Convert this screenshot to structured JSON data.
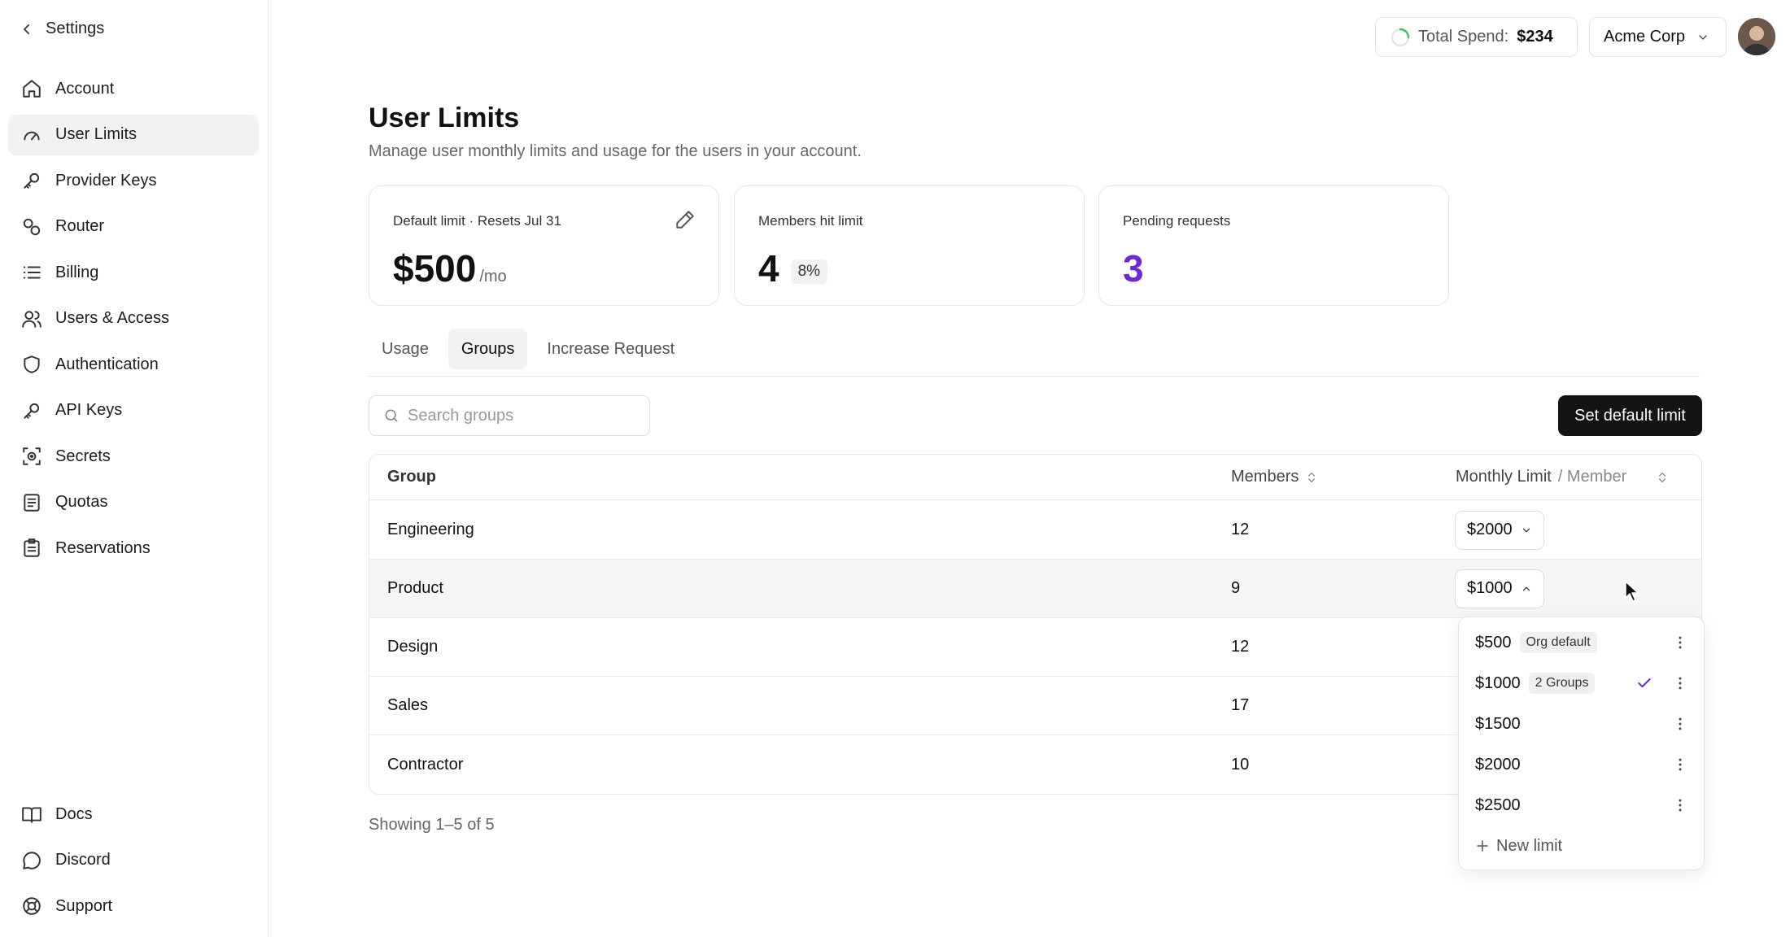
{
  "sidebar": {
    "back_label": "Settings",
    "items": [
      {
        "label": "Account",
        "icon": "home-icon"
      },
      {
        "label": "User Limits",
        "icon": "gauge-icon",
        "active": true
      },
      {
        "label": "Provider Keys",
        "icon": "key-icon"
      },
      {
        "label": "Router",
        "icon": "router-icon"
      },
      {
        "label": "Billing",
        "icon": "list-icon"
      },
      {
        "label": "Users & Access",
        "icon": "users-icon"
      },
      {
        "label": "Authentication",
        "icon": "shield-icon"
      },
      {
        "label": "API Keys",
        "icon": "key-icon"
      },
      {
        "label": "Secrets",
        "icon": "secret-icon"
      },
      {
        "label": "Quotas",
        "icon": "document-icon"
      },
      {
        "label": "Reservations",
        "icon": "clipboard-icon"
      }
    ],
    "bottom_items": [
      {
        "label": "Docs",
        "icon": "book-icon"
      },
      {
        "label": "Discord",
        "icon": "chat-icon"
      },
      {
        "label": "Support",
        "icon": "lifebuoy-icon"
      }
    ]
  },
  "header": {
    "spend_label": "Total Spend:",
    "spend_amount": "$234",
    "org_name": "Acme Corp"
  },
  "page": {
    "title": "User Limits",
    "subtitle": "Manage user monthly limits and usage for the users in your account."
  },
  "cards": {
    "default_limit": {
      "label": "Default limit · Resets Jul 31",
      "value": "$500",
      "suffix": "/mo"
    },
    "members_hit": {
      "label": "Members hit limit",
      "value": "4",
      "chip": "8%"
    },
    "pending": {
      "label": "Pending requests",
      "value": "3"
    }
  },
  "tabs": [
    {
      "label": "Usage"
    },
    {
      "label": "Groups",
      "active": true
    },
    {
      "label": "Increase Request"
    }
  ],
  "search": {
    "placeholder": "Search groups"
  },
  "actions": {
    "set_default_label": "Set default limit"
  },
  "table": {
    "headers": {
      "group": "Group",
      "members": "Members",
      "limit": "Monthly Limit",
      "limit_suffix": "/ Member"
    },
    "rows": [
      {
        "group": "Engineering",
        "members": "12",
        "limit": "$2000"
      },
      {
        "group": "Product",
        "members": "9",
        "limit": "$1000"
      },
      {
        "group": "Design",
        "members": "12"
      },
      {
        "group": "Sales",
        "members": "17"
      },
      {
        "group": "Contractor",
        "members": "10"
      }
    ],
    "footer": "Showing 1–5 of 5"
  },
  "dropdown": {
    "options": [
      {
        "value": "$500",
        "tag": "Org default"
      },
      {
        "value": "$1000",
        "tag": "2 Groups",
        "selected": true
      },
      {
        "value": "$1500"
      },
      {
        "value": "$2000"
      },
      {
        "value": "$2500"
      }
    ],
    "new_label": "New limit"
  },
  "colors": {
    "accent": "#6d28d9",
    "primary_button": "#141414",
    "spinner": "#34c759"
  }
}
